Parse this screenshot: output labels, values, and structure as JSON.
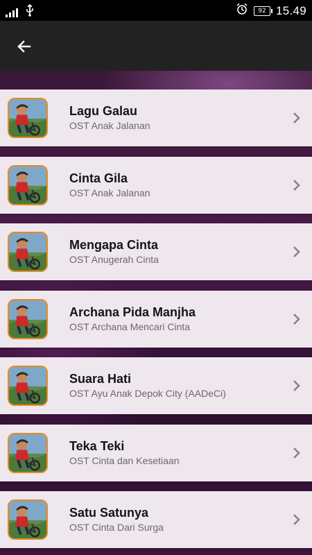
{
  "status_bar": {
    "time": "15.49",
    "battery": "92"
  },
  "app_bar": {
    "back_icon": "arrow-left-icon"
  },
  "colors": {
    "app_bar": "#222222",
    "row_background": "#efe7ee",
    "thumb_border": "#e8891c",
    "title_text": "#141414",
    "subtitle_text": "#6d6670"
  },
  "songs": [
    {
      "title": "Lagu Galau",
      "subtitle": "OST Anak Jalanan"
    },
    {
      "title": "Cinta Gila",
      "subtitle": "OST Anak Jalanan"
    },
    {
      "title": "Mengapa Cinta",
      "subtitle": "OST Anugerah Cinta"
    },
    {
      "title": "Archana Pida Manjha",
      "subtitle": "OST Archana Mencari Cinta"
    },
    {
      "title": "Suara Hati",
      "subtitle": "OST Ayu Anak Depok City (AADeCi)"
    },
    {
      "title": "Teka Teki",
      "subtitle": "OST Cinta dan Kesetiaan"
    },
    {
      "title": "Satu Satunya",
      "subtitle": "OST Cinta Dari Surga"
    }
  ]
}
